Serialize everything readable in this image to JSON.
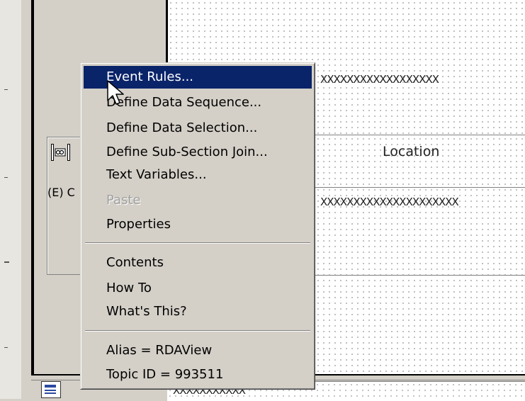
{
  "context_menu": {
    "items": [
      {
        "label": "Event Rules...",
        "state": "highlighted"
      },
      {
        "label": "Define Data Sequence...",
        "state": "normal"
      },
      {
        "label": "Define Data Selection...",
        "state": "normal"
      },
      {
        "label": "Define Sub-Section Join...",
        "state": "normal"
      },
      {
        "label": "Text Variables...",
        "state": "normal"
      },
      {
        "label": "Paste",
        "state": "disabled"
      },
      {
        "label": "Properties",
        "state": "normal"
      },
      {
        "label": "Contents",
        "state": "normal"
      },
      {
        "label": "How To",
        "state": "normal"
      },
      {
        "label": "What's This?",
        "state": "normal"
      },
      {
        "label": "Alias = RDAView",
        "state": "normal"
      },
      {
        "label": "Topic ID = 993511",
        "state": "normal"
      }
    ]
  },
  "canvas": {
    "row1_placeholder": "XXXXXXXXXXXXXXXXXX",
    "column_header": "Location",
    "row2_placeholder": "XXXXXXXXXXXXXXXXXXXXX",
    "bottom_placeholder": "XXXXXXXXXXX"
  },
  "section": {
    "component_label": "(E) C"
  },
  "colors": {
    "menu_highlight": "#0a246a",
    "menu_background": "#d4d0c8",
    "canvas_background": "#ffffff",
    "disabled_text": "#a0a0a0"
  },
  "icons": {
    "component": "join-section-icon",
    "bottom": "report-section-icon",
    "cursor": "arrow-cursor-icon"
  }
}
